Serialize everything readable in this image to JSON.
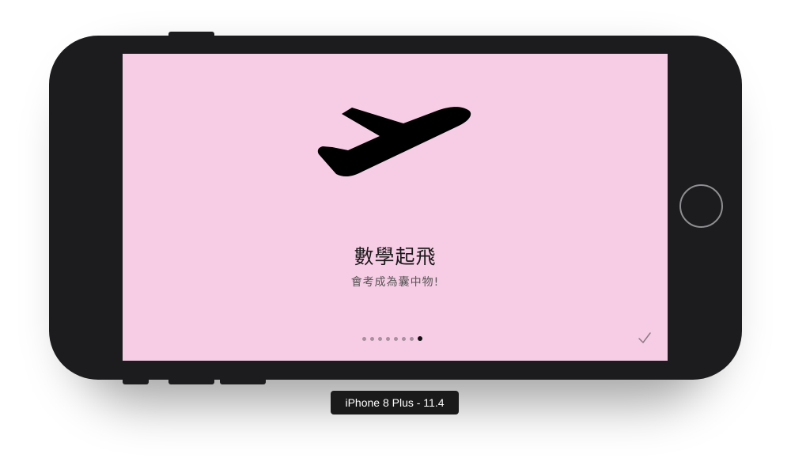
{
  "onboarding": {
    "title": "數學起飛",
    "subtitle": "會考成為囊中物!",
    "page_count": 8,
    "current_page": 8,
    "background_color": "#f7cde5",
    "illustration_icon": "airplane-takeoff-icon",
    "done_icon": "checkmark-icon"
  },
  "simulator": {
    "device_label": "iPhone 8 Plus - 11.4"
  }
}
